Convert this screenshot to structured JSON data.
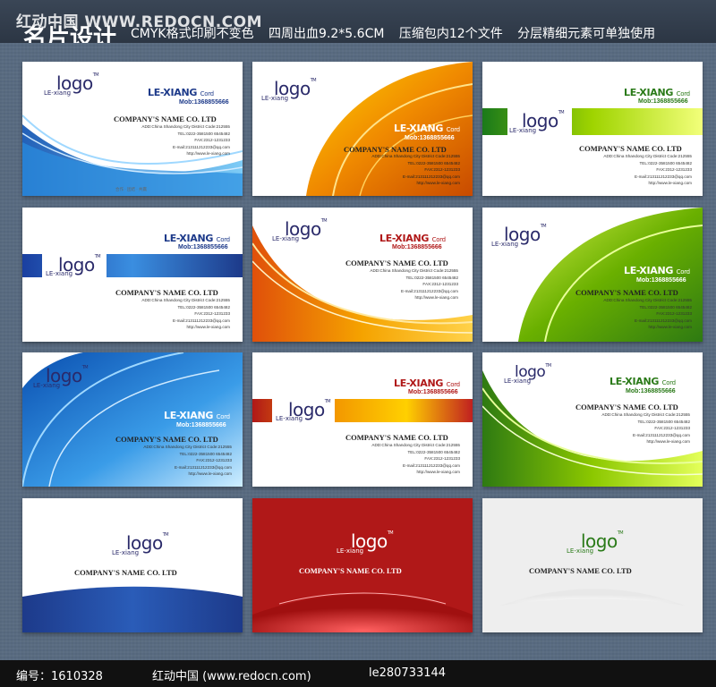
{
  "header": {
    "watermark": "红动中国 WWW.REDOCN.COM",
    "title": "名片设计",
    "specs": [
      "CMYK格式印刷不变色",
      "四周出血9.2*5.6CM",
      "压缩包内12个文件",
      "分层精细元素可单独使用"
    ]
  },
  "card_text": {
    "logo": "logo",
    "tm": "TM",
    "le_xiang_small": "LE-xiang",
    "brand": "LE-XIANG",
    "brand_suffix": "Cord",
    "mob": "Mob:1368855666",
    "company": "COMPANY'S NAME CO. LTD",
    "address": "ADD:China Shandong City District   Code:212555",
    "tel": "TEL:0222-3581500  6545482",
    "fax": "FAX:2312-1231233",
    "email": "E-mail:213111212233@qq.com",
    "web": "http://www.le-xiang.com",
    "bottom_note": "合作 · 团结 · 共赢"
  },
  "colors": {
    "blue": "#1a6fc4",
    "orange": "#f08a00",
    "green": "#6ab000",
    "red": "#b01818",
    "navy": "#1d3a8a"
  },
  "footer": {
    "id_label": "编号：1610328",
    "site": "红动中国 (www.redocn.com)",
    "author": "le280733144"
  }
}
